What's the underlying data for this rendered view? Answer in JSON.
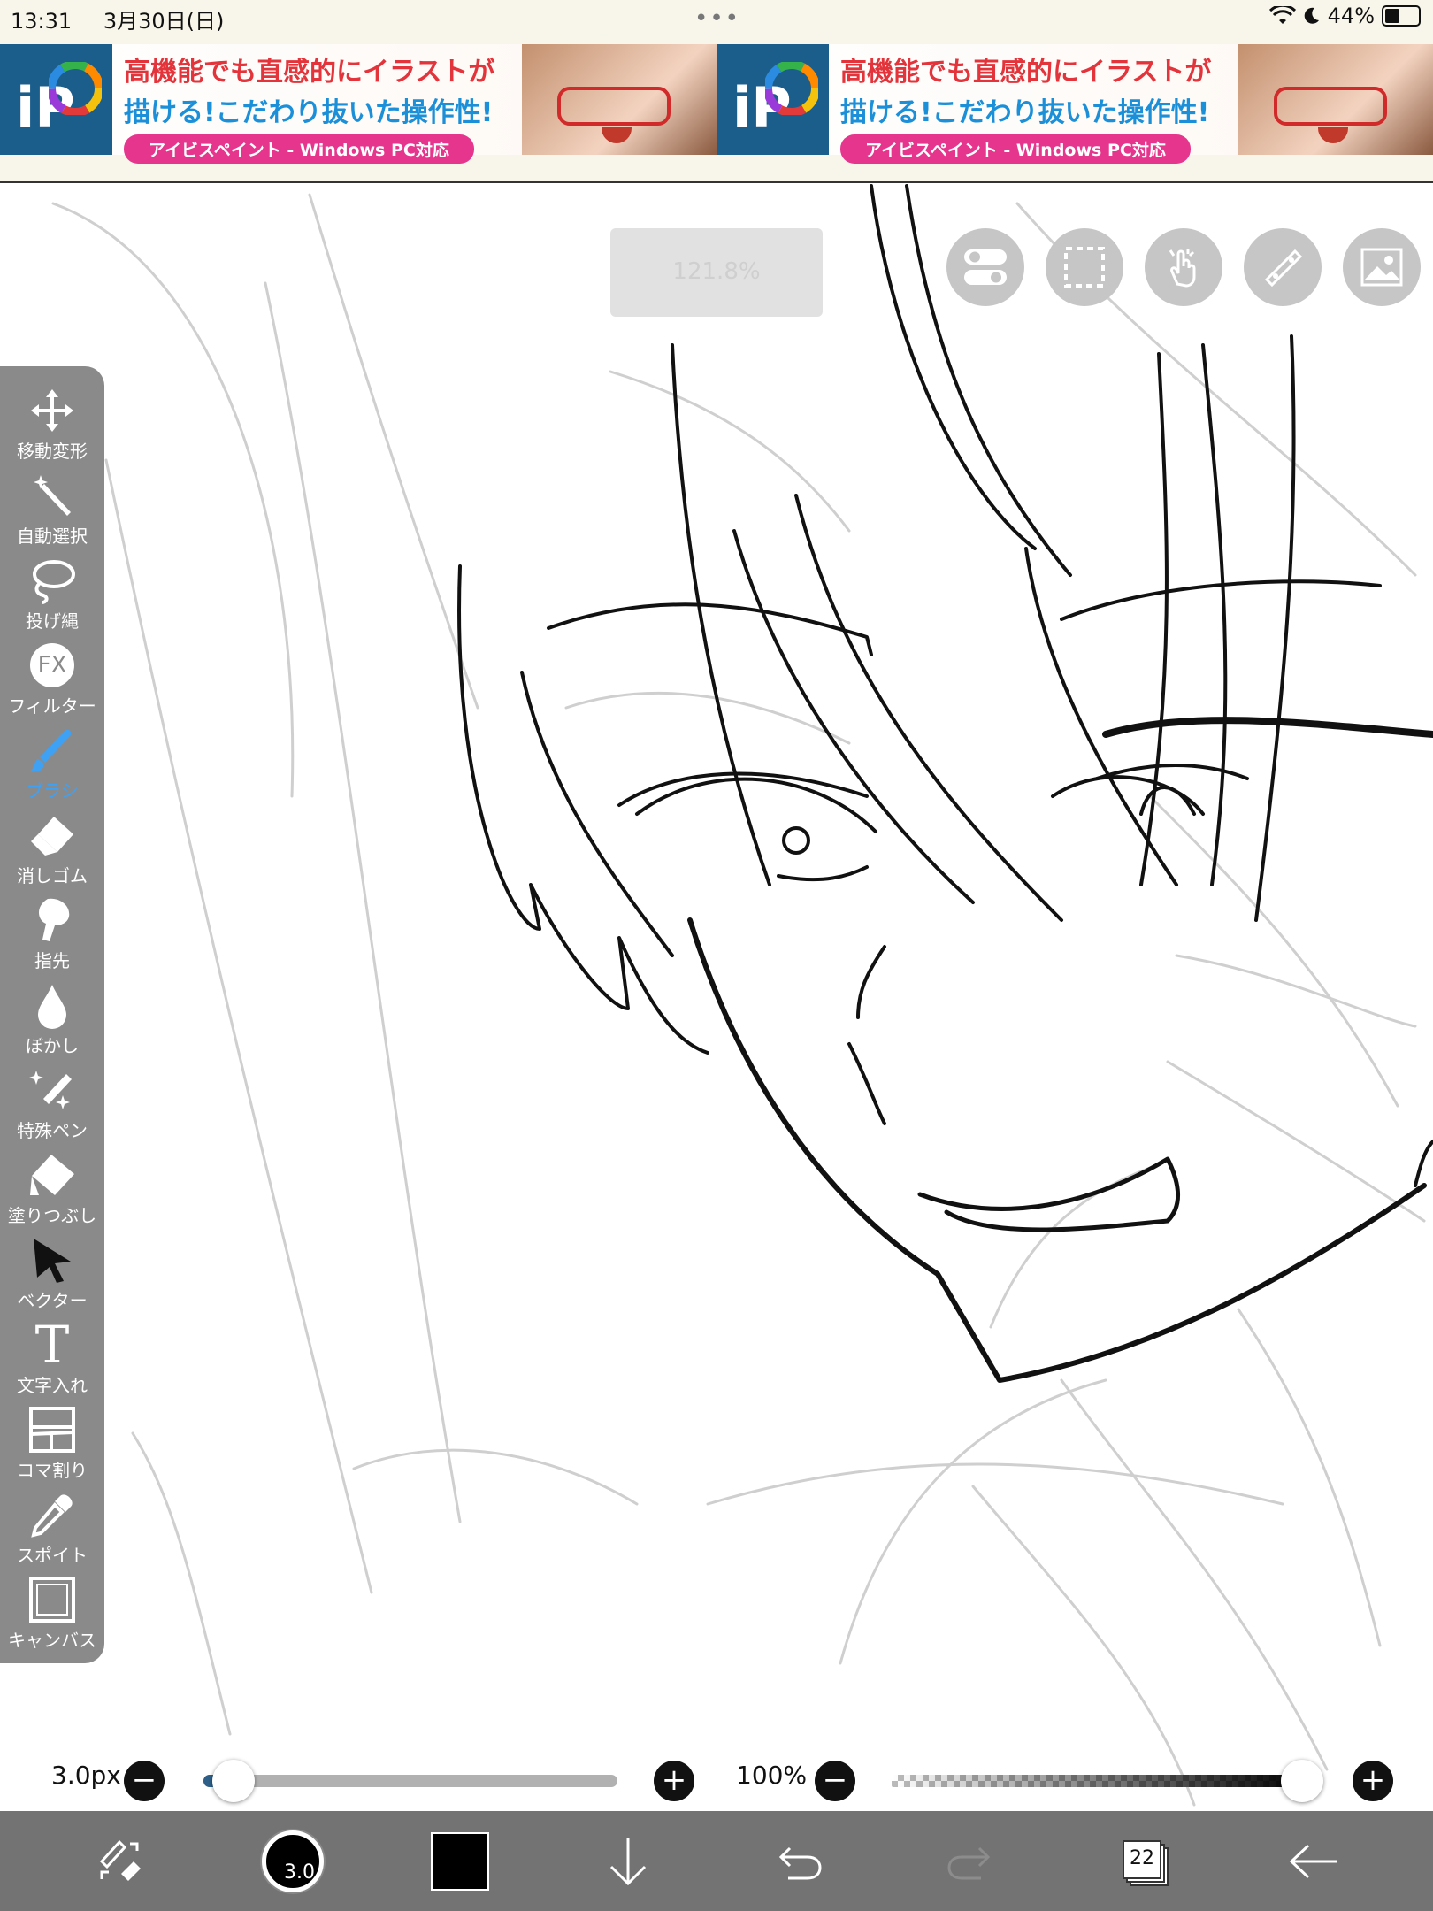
{
  "status": {
    "time": "13:31",
    "date": "3月30日(日)",
    "dots": "•••",
    "battery_pct": "44%",
    "battery_level": 0.44
  },
  "ads": [
    {
      "logo": "iP",
      "line1": "高機能でも直感的にイラストが",
      "line2": "描ける!こだわり抜いた操作性!",
      "pill": "アイビスペイント - Windows PC対応"
    },
    {
      "logo": "iP",
      "line1": "高機能でも直感的にイラストが",
      "line2": "描ける!こだわり抜いた操作性!",
      "pill": "アイビスペイント - Windows PC対応"
    }
  ],
  "zoom_overlay": "121.8%",
  "top_tools": [
    "toggle-icon",
    "selection-icon",
    "touch-icon",
    "ruler-icon",
    "image-icon"
  ],
  "tools": [
    {
      "label": "移動変形",
      "icon": "move-icon"
    },
    {
      "label": "自動選択",
      "icon": "magic-wand-icon"
    },
    {
      "label": "投げ縄",
      "icon": "lasso-icon"
    },
    {
      "label": "フィルター",
      "icon": "fx-icon",
      "glyph": "FX"
    },
    {
      "label": "ブラシ",
      "icon": "brush-icon",
      "active": true
    },
    {
      "label": "消しゴム",
      "icon": "eraser-icon"
    },
    {
      "label": "指先",
      "icon": "smudge-icon"
    },
    {
      "label": "ぼかし",
      "icon": "blur-icon"
    },
    {
      "label": "特殊ペン",
      "icon": "special-pen-icon"
    },
    {
      "label": "塗りつぶし",
      "icon": "fill-icon"
    },
    {
      "label": "ベクター",
      "icon": "vector-icon"
    },
    {
      "label": "文字入れ",
      "icon": "text-icon",
      "glyph": "T"
    },
    {
      "label": "コマ割り",
      "icon": "frame-divider-icon"
    },
    {
      "label": "スポイト",
      "icon": "eyedropper-icon"
    },
    {
      "label": "キャンバス",
      "icon": "canvas-icon"
    }
  ],
  "brush_size": {
    "label": "3.0px",
    "level": 0.03
  },
  "opacity": {
    "label": "100%",
    "level": 1.0
  },
  "bottom": {
    "brush_size_value": "3.0",
    "color": "#000000",
    "layer_count": "22"
  },
  "colors": {
    "accent": "#3fa1f3",
    "panel": "#8a8a8a",
    "bottombar": "#737373"
  }
}
